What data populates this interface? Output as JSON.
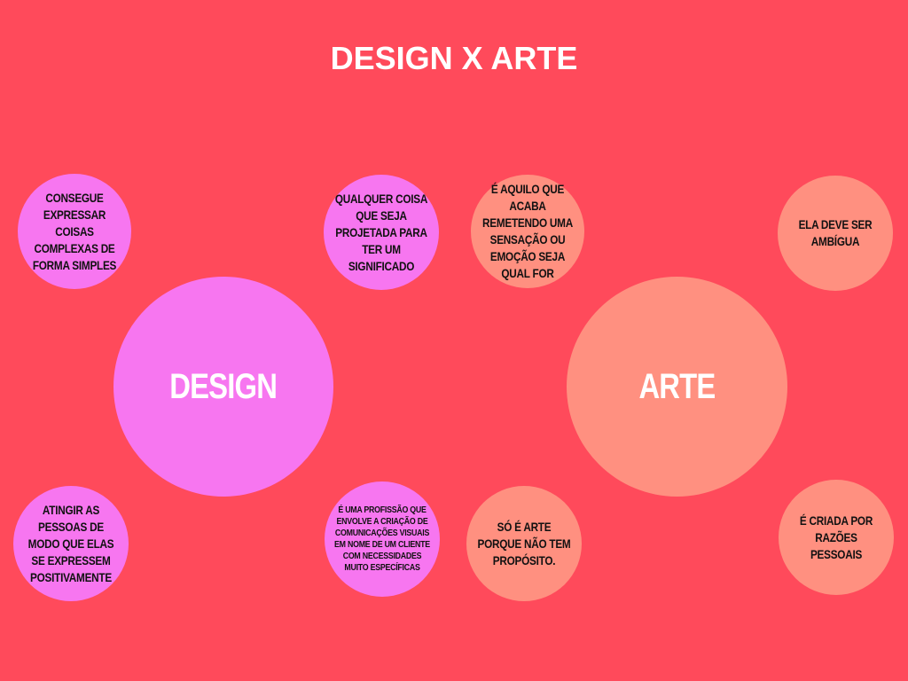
{
  "colors": {
    "background": "#ff4a5b",
    "design": "#f776f0",
    "arte": "#ff9080",
    "title_text": "#ffffff",
    "node_text": "#111111"
  },
  "title": "DESIGN X ARTE",
  "design": {
    "label": "DESIGN",
    "items": [
      "CONSEGUE EXPRESSAR COISAS COMPLEXAS DE FORMA SIMPLES",
      "QUALQUER COISA QUE SEJA PROJETADA PARA TER UM SIGNIFICADO",
      "ATINGIR AS PESSOAS DE MODO QUE ELAS SE EXPRESSEM POSITIVAMENTE",
      "É UMA PROFISSÃO QUE ENVOLVE A CRIAÇÃO DE COMUNICAÇÕES VISUAIS EM NOME DE UM CLIENTE COM NECESSIDADES MUITO ESPECÍFICAS"
    ]
  },
  "arte": {
    "label": "ARTE",
    "items": [
      "É AQUILO QUE ACABA REMETENDO UMA SENSAÇÃO OU EMOÇÃO SEJA QUAL FOR",
      "ELA DEVE SER AMBÍGUA",
      "SÓ É ARTE PORQUE NÃO TEM PROPÓSITO.",
      "É CRIADA POR RAZÕES PESSOAIS"
    ]
  }
}
